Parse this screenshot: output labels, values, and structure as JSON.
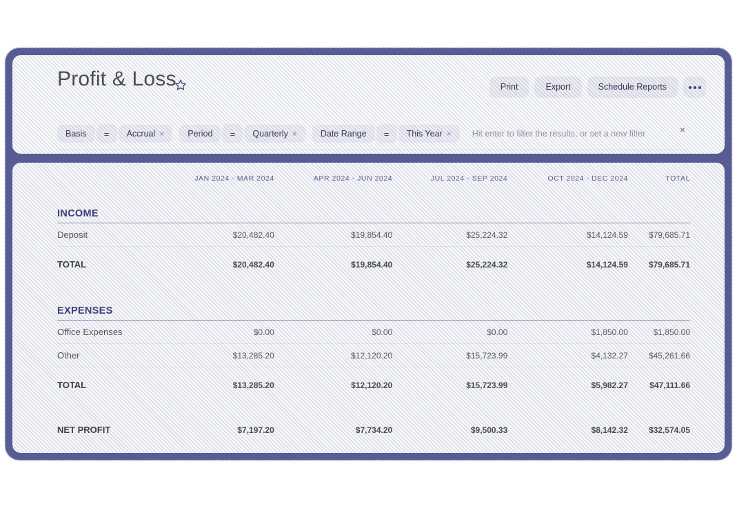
{
  "report": {
    "title": "Profit & Loss",
    "favorite_icon": "star-outline-icon"
  },
  "toolbar": {
    "print_label": "Print",
    "export_label": "Export",
    "schedule_label": "Schedule Reports",
    "more_label": "More options"
  },
  "filters": {
    "clear_all_label": "×",
    "input_placeholder": "Hit enter to filter the results, or set a new filter",
    "input_value": "",
    "chips": [
      {
        "field": "Basis",
        "operator": "=",
        "value": "Accrual",
        "remove_label": "×"
      },
      {
        "field": "Period",
        "operator": "=",
        "value": "Quarterly",
        "remove_label": "×"
      },
      {
        "field": "Date Range",
        "operator": "=",
        "value": "This Year",
        "remove_label": "×"
      }
    ]
  },
  "table": {
    "columns": [
      "",
      "JAN 2024 - MAR 2024",
      "APR 2024 - JUN 2024",
      "JUL 2024 - SEP 2024",
      "OCT 2024 - DEC 2024",
      "TOTAL"
    ],
    "sections": [
      {
        "name": "INCOME",
        "rows": [
          {
            "label": "Deposit",
            "values": [
              "$20,482.40",
              "$19,854.40",
              "$25,224.32",
              "$14,124.59",
              "$79,685.71"
            ]
          }
        ],
        "total": {
          "label": "TOTAL",
          "values": [
            "$20,482.40",
            "$19,854.40",
            "$25,224.32",
            "$14,124.59",
            "$79,685.71"
          ]
        }
      },
      {
        "name": "EXPENSES",
        "rows": [
          {
            "label": "Office Expenses",
            "values": [
              "$0.00",
              "$0.00",
              "$0.00",
              "$1,850.00",
              "$1,850.00"
            ]
          },
          {
            "label": "Other",
            "values": [
              "$13,285.20",
              "$12,120.20",
              "$15,723.99",
              "$4,132.27",
              "$45,261.66"
            ]
          }
        ],
        "total": {
          "label": "TOTAL",
          "values": [
            "$13,285.20",
            "$12,120.20",
            "$15,723.99",
            "$5,982.27",
            "$47,111.66"
          ]
        }
      }
    ],
    "net_profit": {
      "label": "NET PROFIT",
      "values": [
        "$7,197.20",
        "$7,734.20",
        "$9,500.33",
        "$8,142.32",
        "$32,574.05"
      ]
    }
  },
  "colors": {
    "frame": "#575C95",
    "section_heading": "#3c3b78",
    "column_header": "#5f6195",
    "chip_bg": "#f1f2f7",
    "button_bg": "#f1f1f4"
  }
}
